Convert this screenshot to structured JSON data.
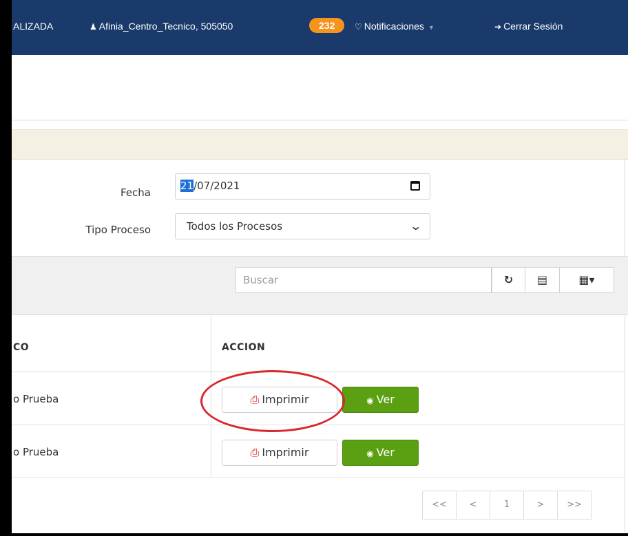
{
  "topbar": {
    "status": "ALIZADA",
    "user": "Afinia_Centro_Tecnico, 505050",
    "badge": "232",
    "notifications": "Notificaciones",
    "logout": "Cerrar Sesión"
  },
  "filters": {
    "fecha_label": "Fecha",
    "fecha_day": "21",
    "fecha_rest": "/07/2021",
    "tipo_label": "Tipo Proceso",
    "tipo_value": "Todos los Procesos"
  },
  "toolbar": {
    "search_placeholder": "Buscar",
    "refresh_icon": "↻",
    "columns_icon": "▤",
    "grid_icon": "▦▾"
  },
  "table": {
    "headers": [
      "CO",
      "ACCION"
    ],
    "rows": [
      {
        "name": "o Prueba",
        "print_label": "Imprimir",
        "view_label": "Ver"
      },
      {
        "name": "o Prueba",
        "print_label": "Imprimir",
        "view_label": "Ver"
      }
    ]
  },
  "pager": {
    "first": "<<",
    "prev": "<",
    "page": "1",
    "next": ">",
    "last": ">>"
  },
  "colors": {
    "topbar": "#1a3a6b",
    "badge": "#f7941d",
    "view_button": "#5aa012",
    "highlight": "#d9262c"
  }
}
